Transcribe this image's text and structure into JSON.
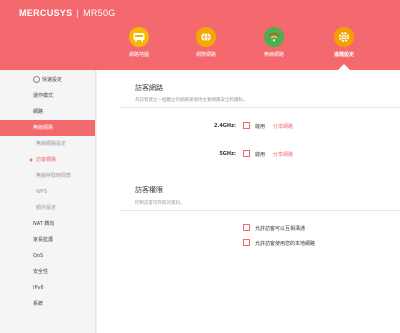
{
  "header": {
    "brand": "MERCUSYS",
    "separator": "|",
    "model": "MR50G",
    "nav": [
      {
        "label": "網路地圖",
        "icon": "network-map-icon"
      },
      {
        "label": "網際網路",
        "icon": "internet-globe-icon"
      },
      {
        "label": "無線網路",
        "icon": "wifi-icon"
      },
      {
        "label": "進階設定",
        "icon": "gear-icon"
      }
    ]
  },
  "sidebar": {
    "items": [
      {
        "label": "快速設定",
        "type": "top"
      },
      {
        "label": "運作模式",
        "type": "normal"
      },
      {
        "label": "網路",
        "type": "normal"
      },
      {
        "label": "無線網路",
        "type": "active"
      },
      {
        "label": "無線網路設定",
        "type": "sub"
      },
      {
        "label": "訪客網路",
        "type": "sub-current"
      },
      {
        "label": "無線存取時間表",
        "type": "sub"
      },
      {
        "label": "WPS",
        "type": "sub"
      },
      {
        "label": "額外設定",
        "type": "sub"
      },
      {
        "label": "NAT 轉向",
        "type": "normal"
      },
      {
        "label": "家長監護",
        "type": "normal"
      },
      {
        "label": "QoS",
        "type": "normal"
      },
      {
        "label": "安全性",
        "type": "normal"
      },
      {
        "label": "IPv6",
        "type": "normal"
      },
      {
        "label": "系統",
        "type": "normal"
      }
    ]
  },
  "guest_network": {
    "title": "訪客網路",
    "description": "為訪客建立一個獨立的網路來保持主要網路安全和隱私。",
    "band_24": {
      "label": "2.4GHz:",
      "enable_text": "啟用",
      "link_text": "分享網路",
      "checked": false
    },
    "band_5": {
      "label": "5GHz:",
      "enable_text": "啟用",
      "link_text": "分享網路",
      "checked": false
    }
  },
  "guest_permissions": {
    "title": "訪客權限",
    "description": "控制訪客可存取的資料。",
    "options": [
      {
        "text": "允許訪客可以互相溝通",
        "checked": false
      },
      {
        "text": "允許訪客使用您的本地網路",
        "checked": false
      }
    ]
  },
  "colors": {
    "accent": "#f4696d",
    "nav_icon_map": "#f5b800",
    "nav_icon_internet": "#f5a800",
    "nav_icon_wifi": "#4caf50",
    "nav_icon_advanced": "#f5a000"
  }
}
